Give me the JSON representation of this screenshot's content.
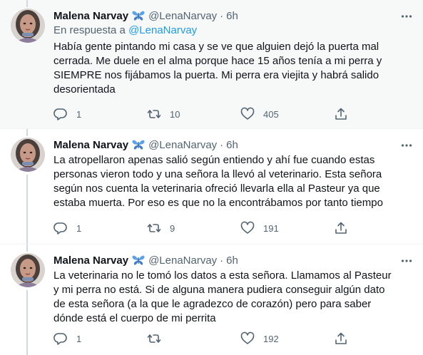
{
  "tweets": [
    {
      "name": "Malena Narvay",
      "badge": "butterfly-emoji",
      "handle": "@LenaNarvay",
      "dot": "·",
      "time": "6h",
      "reply_prefix": "En respuesta a",
      "reply_mention": "@LenaNarvay",
      "text": "Había gente pintando mi casa y se ve que alguien dejó la puerta mal cerrada. Me duele en el alma porque hace 15 años tenía a mi perra y SIEMPRE nos fijábamos la puerta. Mi perra era viejita y habrá salido desorientada",
      "replies": "1",
      "retweets": "10",
      "likes": "405"
    },
    {
      "name": "Malena Narvay",
      "badge": "butterfly-emoji",
      "handle": "@LenaNarvay",
      "dot": "·",
      "time": "6h",
      "text": "La atropellaron apenas salió según entiendo y ahí fue cuando estas personas vieron todo y una señora la llevó al veterinario. Esta señora según nos cuenta la veterinaria ofreció llevarla ella al Pasteur ya que estaba muerta. Por eso es que no la encontrábamos por tanto tiempo",
      "replies": "1",
      "retweets": "9",
      "likes": "191"
    },
    {
      "name": "Malena Narvay",
      "badge": "butterfly-emoji",
      "handle": "@LenaNarvay",
      "dot": "·",
      "time": "6h",
      "text": "La veterinaria no le tomó los datos a esta señora. Llamamos al Pasteur y mi perra no está. Si de alguna manera pudiera conseguir algún dato de esta señora (a la que le agradezco de corazón) pero para saber dónde está el cuerpo de mi perrita",
      "replies": "1",
      "retweets": "",
      "likes": "192"
    }
  ],
  "colors": {
    "text": "#0f1419",
    "secondary": "#536471",
    "link": "#1d9bf0",
    "highlight_bg": "#f7f9f9",
    "thread_line": "#cfd9de",
    "butterfly": "#4a90e2"
  }
}
